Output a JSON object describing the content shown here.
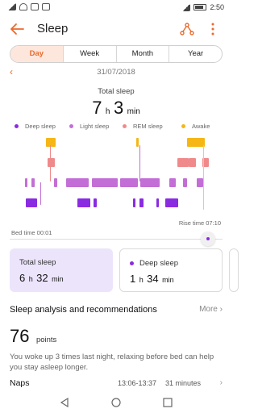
{
  "status_bar": {
    "time": "2:50"
  },
  "header": {
    "title": "Sleep"
  },
  "tabs": [
    {
      "label": "Day",
      "active": true
    },
    {
      "label": "Week",
      "active": false
    },
    {
      "label": "Month",
      "active": false
    },
    {
      "label": "Year",
      "active": false
    }
  ],
  "date": "31/07/2018",
  "total_sleep": {
    "label": "Total sleep",
    "hours": "7",
    "h_unit": "h",
    "minutes": "3",
    "m_unit": "min"
  },
  "legend": [
    {
      "label": "Deep sleep",
      "color": "#8a2be2"
    },
    {
      "label": "Light sleep",
      "color": "#c36ed6"
    },
    {
      "label": "REM sleep",
      "color": "#f08a8a"
    },
    {
      "label": "Awake",
      "color": "#f5b616"
    }
  ],
  "chart": {
    "rise_time": "Rise time 07:10",
    "bed_time": "Bed time 00:01"
  },
  "cards": [
    {
      "title": "Total sleep",
      "hours": "6",
      "h_unit": "h",
      "minutes": "32",
      "m_unit": "min"
    },
    {
      "title": "Deep sleep",
      "hours": "1",
      "h_unit": "h",
      "minutes": "34",
      "m_unit": "min"
    }
  ],
  "analysis": {
    "title": "Sleep analysis and recommendations",
    "more": "More",
    "points": "76",
    "points_label": "points",
    "advice": "You woke up 3 times last night, relaxing before bed can help you stay asleep longer."
  },
  "naps": {
    "label": "Naps",
    "time": "13:06-13:37",
    "duration": "31 minutes"
  }
}
